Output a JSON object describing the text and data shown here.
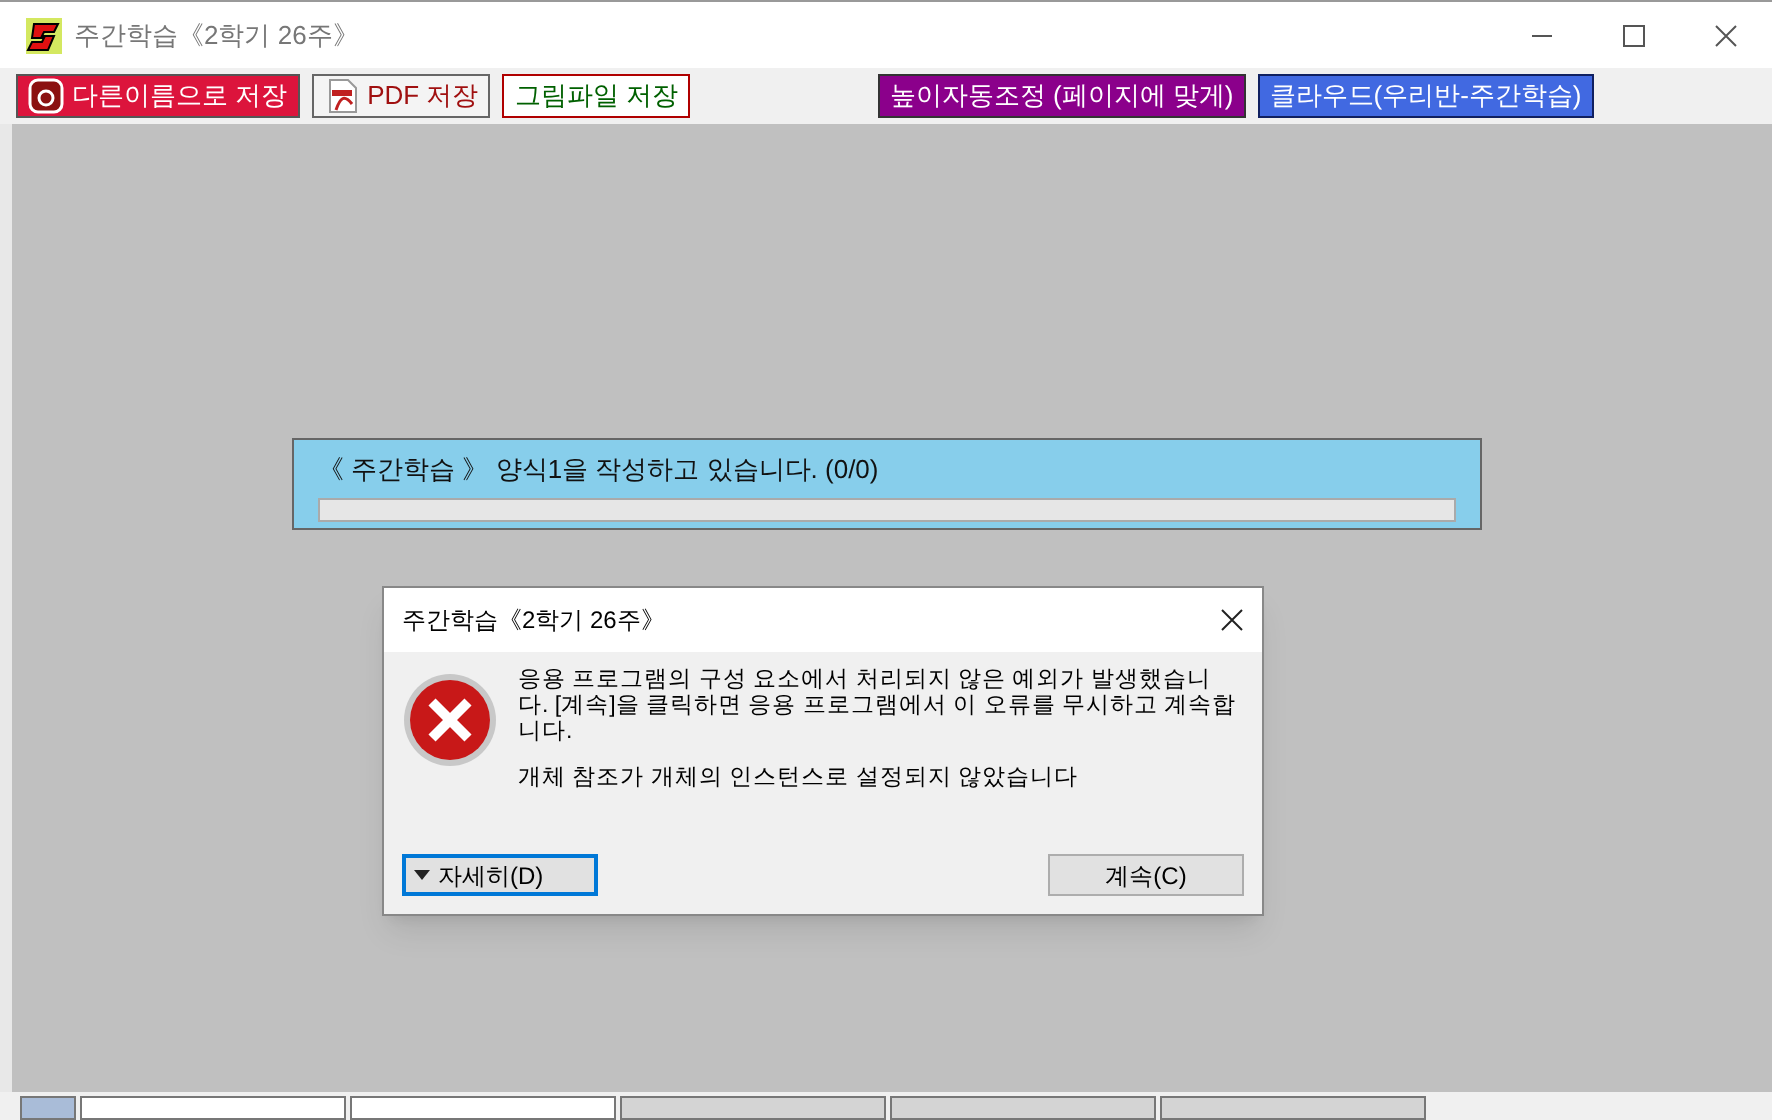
{
  "window": {
    "title": "주간학습《2학기 26주》"
  },
  "toolbar": [
    {
      "label": "다른이름으로 저장",
      "kind": "hwp"
    },
    {
      "label": "PDF 저장",
      "kind": "pdf"
    },
    {
      "label": "그림파일 저장",
      "kind": "image"
    },
    {
      "label": "높이자동조정 (페이지에 맞게)",
      "kind": "fit"
    },
    {
      "label": "클라우드(우리반-주간학습)",
      "kind": "cloud"
    }
  ],
  "progress": {
    "message": "《 주간학습 》 양식1을 작성하고 있습니다. (0/0)"
  },
  "dialog": {
    "title": "주간학습《2학기 26주》",
    "message": "응용 프로그램의 구성 요소에서 처리되지 않은 예외가 발생했습니다. [계속]을 클릭하면 응용 프로그램에서 이 오류를 무시하고 계속합니다.",
    "detail": "개체 참조가 개체의 인스턴스로 설정되지 않았습니다",
    "details_button": "자세히(D)",
    "continue_button": "계속(C)"
  }
}
